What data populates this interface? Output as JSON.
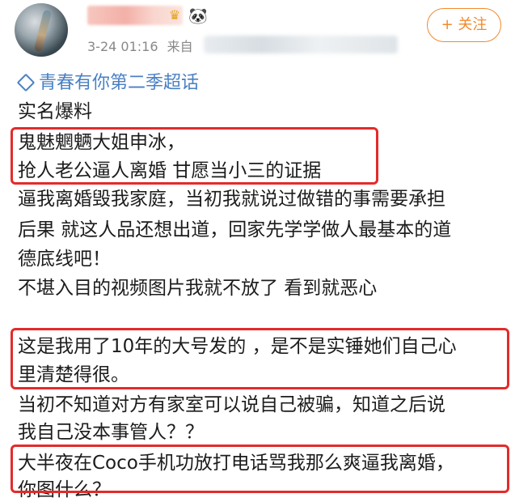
{
  "post": {
    "badge_crown": "♛",
    "badge_panda": "🐼",
    "timestamp": "3-24 01:16",
    "source_prefix": "来自",
    "follow_label": "+ 关注",
    "topic": "青春有你第二季超话",
    "lines": [
      "实名爆料",
      "鬼魅魍魉大姐申冰，",
      "抢人老公逼人离婚 甘愿当小三的证据",
      "逼我离婚毁我家庭，当初我就说过做错的事需要承担",
      "后果 就这人品还想出道，回家先学学做人最基本的道",
      "德底线吧！",
      "不堪入目的视频图片我就不放了 看到就恶心",
      "这是我用了10年的大号发的 ，是不是实锤她们自己心",
      "里清楚得很。",
      "当初不知道对方有家室可以说自己被骗，知道之后说",
      "我自己没本事管人？？",
      "大半夜在Coco手机功放打电话骂我那么爽逼我离婚，",
      "你图什么？"
    ]
  },
  "colors": {
    "accent_orange": "#f28a2c",
    "topic_blue": "#4a80c4",
    "highlight_red": "#e32b2b",
    "meta_gray": "#888888"
  }
}
